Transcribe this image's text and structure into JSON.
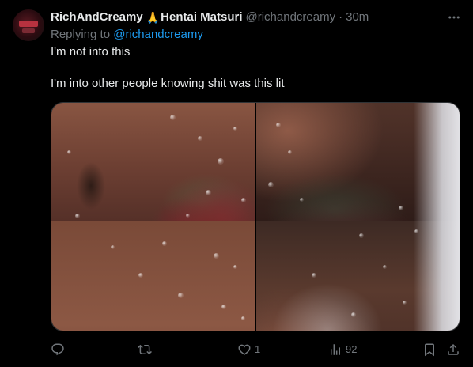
{
  "tweet": {
    "display_name": "RichAndCreamy",
    "emoji": "🙏",
    "display_name_suffix": "Hentai Matsuri",
    "handle": "@richandcreamy",
    "separator": "·",
    "time": "30m",
    "replying_prefix": "Replying to",
    "replying_to": "@richandcreamy",
    "text_line1": "I'm not into this",
    "text_line2": "I'm into other people knowing shit was this lit"
  },
  "actions": {
    "reply_count": "",
    "retweet_count": "",
    "like_count": "1",
    "views_count": "92"
  },
  "icons": {
    "more": "more-icon",
    "reply": "reply-icon",
    "retweet": "retweet-icon",
    "like": "heart-icon",
    "views": "views-icon",
    "bookmark": "bookmark-icon",
    "share": "share-icon"
  },
  "colors": {
    "background": "#000000",
    "text_primary": "#e7e9ea",
    "text_secondary": "#71767b",
    "accent": "#1d9bf0",
    "border": "#2f3336"
  }
}
